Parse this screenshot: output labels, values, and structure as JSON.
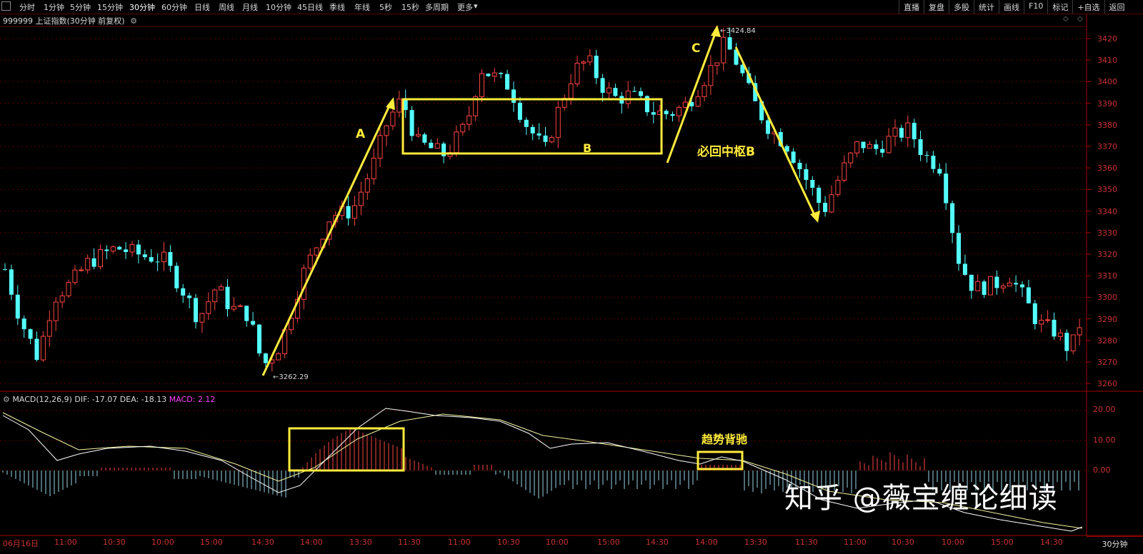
{
  "toolbar": {
    "periods": [
      "分时",
      "1分钟",
      "5分钟",
      "15分钟",
      "30分钟",
      "60分钟",
      "日线",
      "周线",
      "月线",
      "10分钟",
      "45日线",
      "季线",
      "年线",
      "5秒",
      "15秒",
      "多周期",
      "更多"
    ],
    "active_period": "30分钟",
    "right_buttons": [
      "直播",
      "复盘",
      "多股",
      "统计",
      "画线",
      "F10",
      "标记",
      "+自选",
      "返回"
    ]
  },
  "header": {
    "title": "999999 上证指数(30分钟 前复权)"
  },
  "price_axis": {
    "labels": [
      "3420",
      "3410",
      "3400",
      "3390",
      "3380",
      "3370",
      "3360",
      "3350",
      "3340",
      "3330",
      "3320",
      "3310",
      "3300",
      "3290",
      "3280",
      "3270",
      "3260"
    ]
  },
  "macd_axis": {
    "labels": [
      "20.00",
      "10.00",
      "0.00"
    ]
  },
  "macd": {
    "label": "MACD(12,26,9)",
    "dif": "DIF: -17.07",
    "dea": "DEA: -18.13",
    "macd": "MACD: 2.12"
  },
  "time_axis": {
    "labels": [
      "06月16日",
      "11:00",
      "10:30",
      "10:00",
      "15:00",
      "14:30",
      "14:00",
      "13:30",
      "11:30",
      "11:00",
      "10:30",
      "10:00",
      "15:00",
      "14:30",
      "14:00",
      "13:30",
      "11:30",
      "11:00",
      "10:30",
      "10:00",
      "15:00",
      "14:30"
    ]
  },
  "period_label": "30分钟",
  "annotations": {
    "a": "A",
    "b": "B",
    "c": "C",
    "return_label": "必回中枢B",
    "divergence": "趋势背驰",
    "low_price": "3262.29",
    "high_price": "3424.84"
  },
  "watermark": "知乎 @薇宝缠论细读",
  "colors": {
    "up": "#ff4444",
    "down": "#54ffff",
    "annotation": "#ffeb3b",
    "axis": "#cc3333"
  }
}
